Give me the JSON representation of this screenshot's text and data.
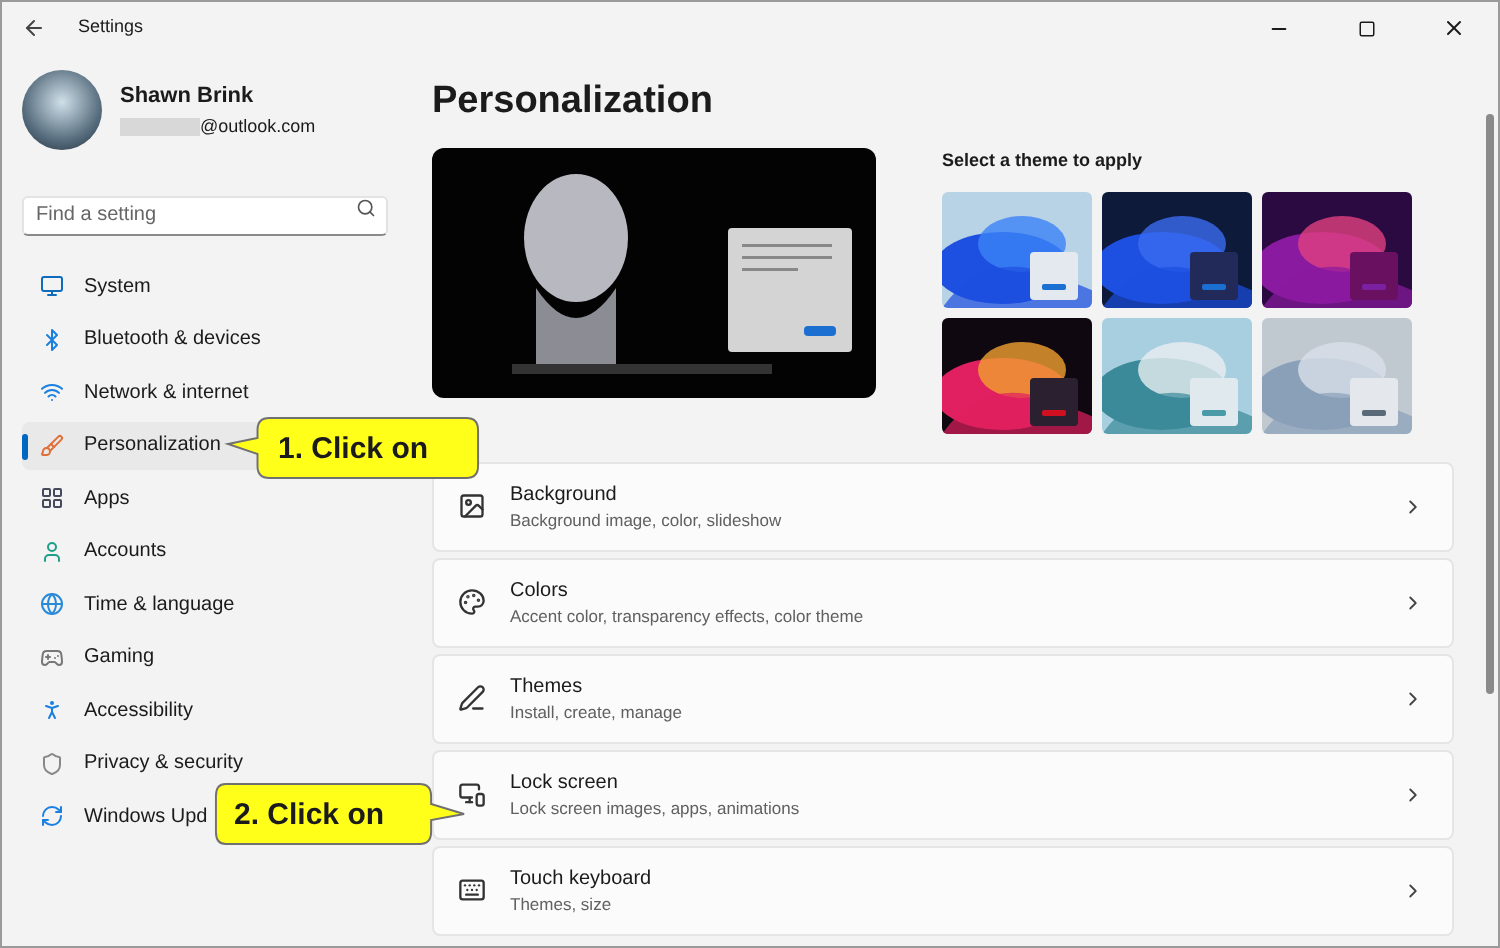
{
  "window": {
    "title": "Settings"
  },
  "account": {
    "name": "Shawn Brink",
    "email": "@outlook.com"
  },
  "search": {
    "placeholder": "Find a setting"
  },
  "sidebar": {
    "items": [
      {
        "kind": "system",
        "label": "System",
        "selected": false
      },
      {
        "kind": "bluetooth",
        "label": "Bluetooth & devices",
        "selected": false
      },
      {
        "kind": "network",
        "label": "Network & internet",
        "selected": false
      },
      {
        "kind": "personalization",
        "label": "Personalization",
        "selected": true
      },
      {
        "kind": "apps",
        "label": "Apps",
        "selected": false
      },
      {
        "kind": "accounts",
        "label": "Accounts",
        "selected": false
      },
      {
        "kind": "time",
        "label": "Time & language",
        "selected": false
      },
      {
        "kind": "gaming",
        "label": "Gaming",
        "selected": false
      },
      {
        "kind": "accessibility",
        "label": "Accessibility",
        "selected": false
      },
      {
        "kind": "privacy",
        "label": "Privacy & security",
        "selected": false
      },
      {
        "kind": "update",
        "label": "Windows Upd",
        "selected": false
      }
    ]
  },
  "page": {
    "title": "Personalization",
    "themes_heading": "Select a theme to apply"
  },
  "cards": [
    {
      "kind": "background",
      "title": "Background",
      "subtitle": "Background image, color, slideshow"
    },
    {
      "kind": "colors",
      "title": "Colors",
      "subtitle": "Accent color, transparency effects, color theme"
    },
    {
      "kind": "themes",
      "title": "Themes",
      "subtitle": "Install, create, manage"
    },
    {
      "kind": "lock",
      "title": "Lock screen",
      "subtitle": "Lock screen images, apps, animations"
    },
    {
      "kind": "keyboard",
      "title": "Touch keyboard",
      "subtitle": "Themes, size"
    }
  ],
  "callouts": [
    {
      "text": "1. Click on"
    },
    {
      "text": "2. Click on"
    }
  ]
}
